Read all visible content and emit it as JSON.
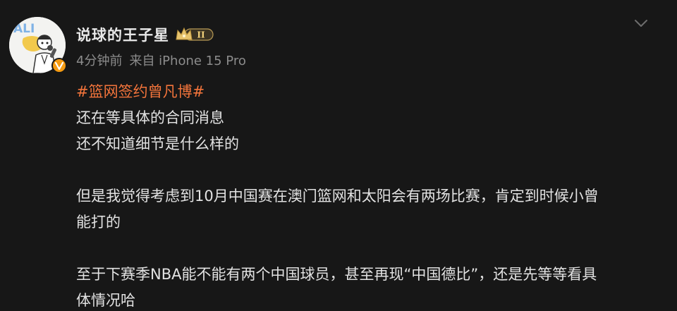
{
  "author": {
    "name": "说球的王子星",
    "vip_level": "II",
    "avatar_text": "ALI"
  },
  "meta": {
    "time": "4分钟前",
    "source": "来自 iPhone 15 Pro"
  },
  "post": {
    "hashtag": "#篮网签约曾凡博#",
    "line1": "还在等具体的合同消息",
    "line2": "还不知道细节是什么样的",
    "para2_line1": "但是我觉得考虑到10月中国赛在澳门篮网和太阳会有两场比赛，肯定到时候小曾",
    "para2_line2": "能打的",
    "para3_line1": "至于下赛季NBA能不能有两个中国球员，甚至再现“中国德比”，还是先等等看具",
    "para3_line2": "体情况哈"
  },
  "colors": {
    "background": "#171717",
    "hashtag": "#f3743b",
    "meta": "#8c8c8c",
    "verified": "#f59b12"
  },
  "icons": {
    "dropdown": "chevron-down-icon",
    "verified": "verified-v-icon",
    "vip": "crown-vip-badge-icon"
  }
}
